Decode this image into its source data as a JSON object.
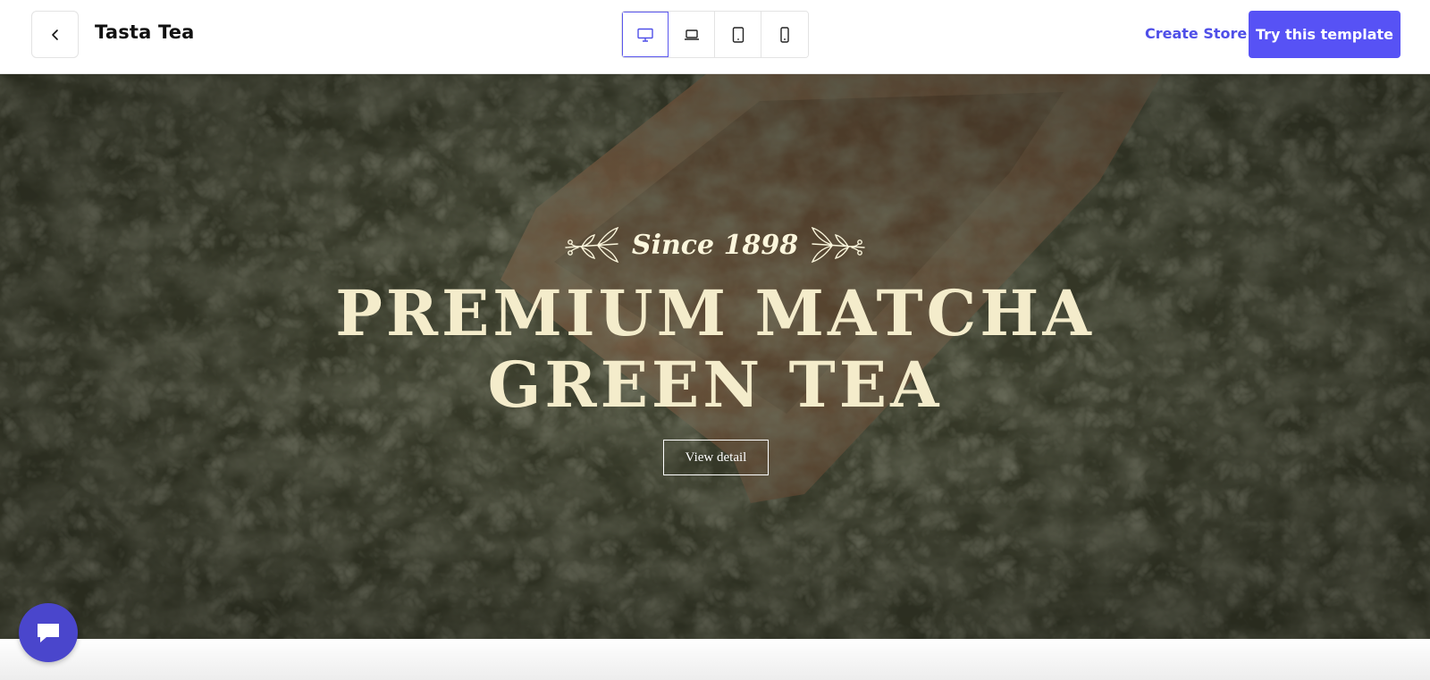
{
  "header": {
    "store_name": "Tasta Tea",
    "back_icon": "chevron-left-icon",
    "devices": [
      {
        "name": "desktop",
        "icon": "desktop-icon",
        "active": true
      },
      {
        "name": "laptop",
        "icon": "laptop-icon",
        "active": false
      },
      {
        "name": "tablet",
        "icon": "tablet-icon",
        "active": false
      },
      {
        "name": "mobile",
        "icon": "mobile-icon",
        "active": false
      }
    ],
    "create_store_label": "Create Store",
    "try_template_label": "Try this template"
  },
  "hero": {
    "since_text": "Since 1898",
    "title_line1": "PREMIUM MATCHA",
    "title_line2": "GREEN TEA",
    "cta_label": "View detail"
  },
  "chat": {
    "icon": "chat-bubble-icon"
  },
  "colors": {
    "accent": "#5752f5",
    "link": "#4f4fe8",
    "hero_title": "#f4eccb",
    "chat_button": "#4a46cc"
  }
}
